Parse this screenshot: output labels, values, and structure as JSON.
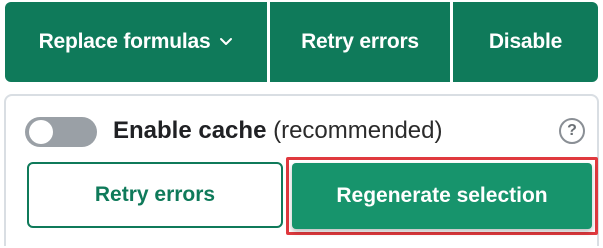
{
  "toolbar": {
    "replace_formulas_label": "Replace formulas",
    "retry_errors_label": "Retry errors",
    "disable_label": "Disable"
  },
  "panel": {
    "cache_label_strong": "Enable cache",
    "cache_label_suffix": "(recommended)",
    "cache_enabled": false,
    "help_icon_glyph": "?",
    "retry_errors_label": "Retry errors",
    "regenerate_label": "Regenerate selection"
  },
  "colors": {
    "brand_green": "#0f7a5a",
    "regen_green": "#17946c",
    "highlight_red": "#e0393e",
    "toggle_off": "#9aa0a6"
  },
  "icons": {
    "dropdown": "chevron-down-icon",
    "help": "help-circle-icon"
  }
}
